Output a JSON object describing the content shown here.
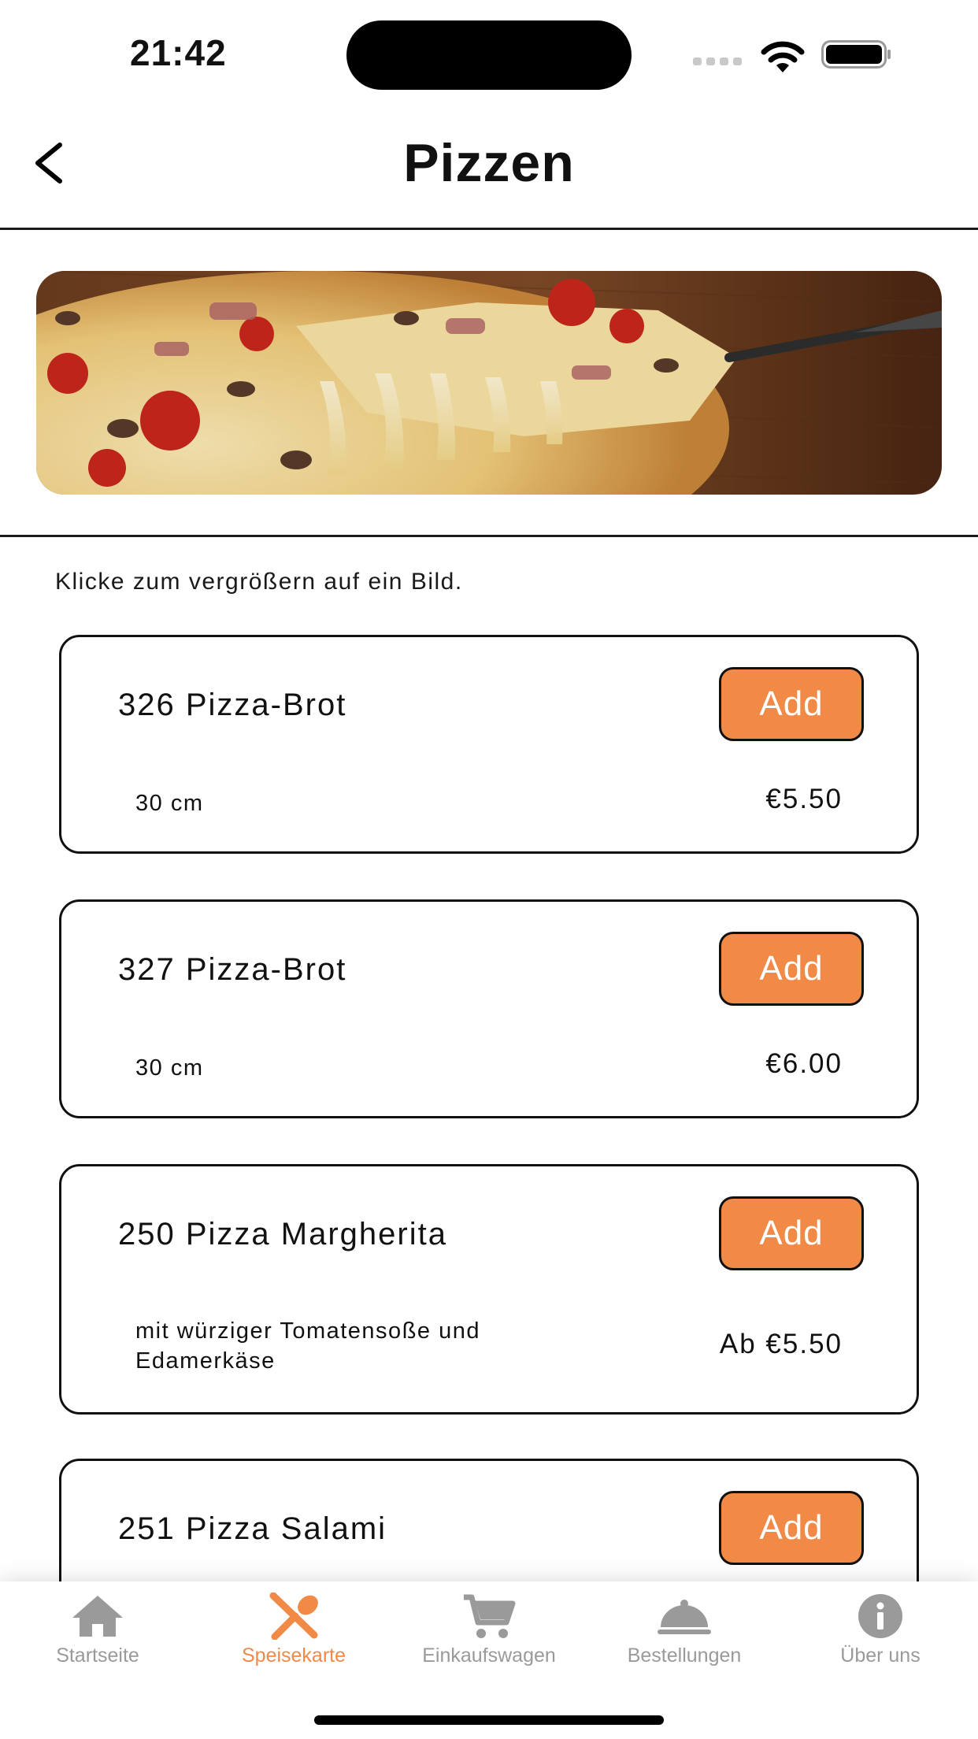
{
  "status_bar": {
    "time": "21:42"
  },
  "header": {
    "title": "Pizzen"
  },
  "hint": "Klicke zum vergrößern auf ein Bild.",
  "items": [
    {
      "name": "326 Pizza-Brot",
      "desc": "30 cm",
      "price": "€5.50",
      "add_label": "Add"
    },
    {
      "name": "327 Pizza-Brot",
      "desc": "30 cm",
      "price": "€6.00",
      "add_label": "Add"
    },
    {
      "name": "250 Pizza Margherita",
      "desc": "mit würziger Tomatensoße und Edamerkäse",
      "price": "Ab €5.50",
      "add_label": "Add"
    },
    {
      "name": "251 Pizza Salami",
      "add_label": "Add"
    }
  ],
  "tabs": [
    {
      "label": "Startseite",
      "icon": "home-icon"
    },
    {
      "label": "Speisekarte",
      "icon": "cutlery-icon",
      "active": true
    },
    {
      "label": "Einkaufswagen",
      "icon": "cart-icon"
    },
    {
      "label": "Bestellungen",
      "icon": "cloche-icon"
    },
    {
      "label": "Über uns",
      "icon": "info-icon"
    }
  ],
  "colors": {
    "accent": "#f08a46",
    "inactive_tab": "#9a9a9a",
    "border": "#111111"
  }
}
